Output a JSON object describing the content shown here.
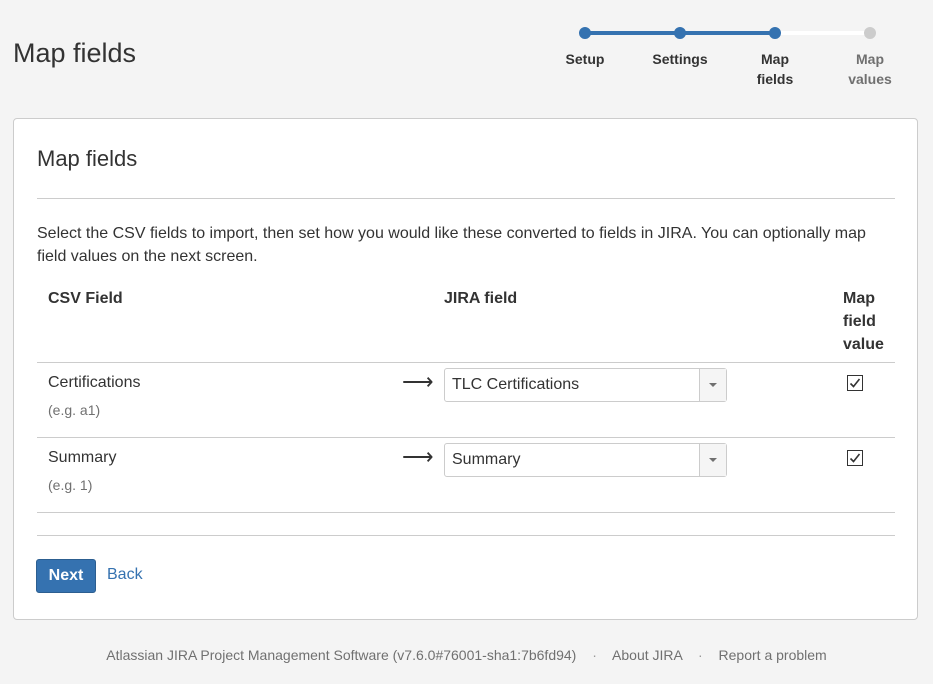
{
  "page": {
    "title": "Map fields"
  },
  "tracker": {
    "steps": [
      {
        "label_line1": "Setup",
        "label_line2": "",
        "state": "done"
      },
      {
        "label_line1": "Settings",
        "label_line2": "",
        "state": "done"
      },
      {
        "label_line1": "Map",
        "label_line2": "fields",
        "state": "current"
      },
      {
        "label_line1": "Map",
        "label_line2": "values",
        "state": "todo"
      }
    ]
  },
  "card": {
    "title": "Map fields",
    "description": "Select the CSV fields to import, then set how you would like these converted to fields in JIRA. You can optionally map field values on the next screen.",
    "columns": {
      "csv_field": "CSV Field",
      "jira_field": "JIRA field",
      "map_value_line1": "Map",
      "map_value_line2": "field",
      "map_value_line3": "value"
    },
    "rows": [
      {
        "csv_field": "Certifications",
        "example": "(e.g. a1)",
        "arrow": "⟶",
        "jira_field": "TLC Certifications",
        "map_value": true
      },
      {
        "csv_field": "Summary",
        "example": "(e.g. 1)",
        "arrow": "⟶",
        "jira_field": "Summary",
        "map_value": true
      }
    ],
    "buttons": {
      "next": "Next",
      "back": "Back"
    }
  },
  "footer": {
    "software": "Atlassian JIRA Project Management Software (v7.6.0#76001-sha1:7b6fd94)",
    "separator": "·",
    "about": "About JIRA",
    "report": "Report a problem"
  },
  "colors": {
    "accent": "#3572b0",
    "background": "#f4f4f4",
    "border": "#cccccc"
  }
}
